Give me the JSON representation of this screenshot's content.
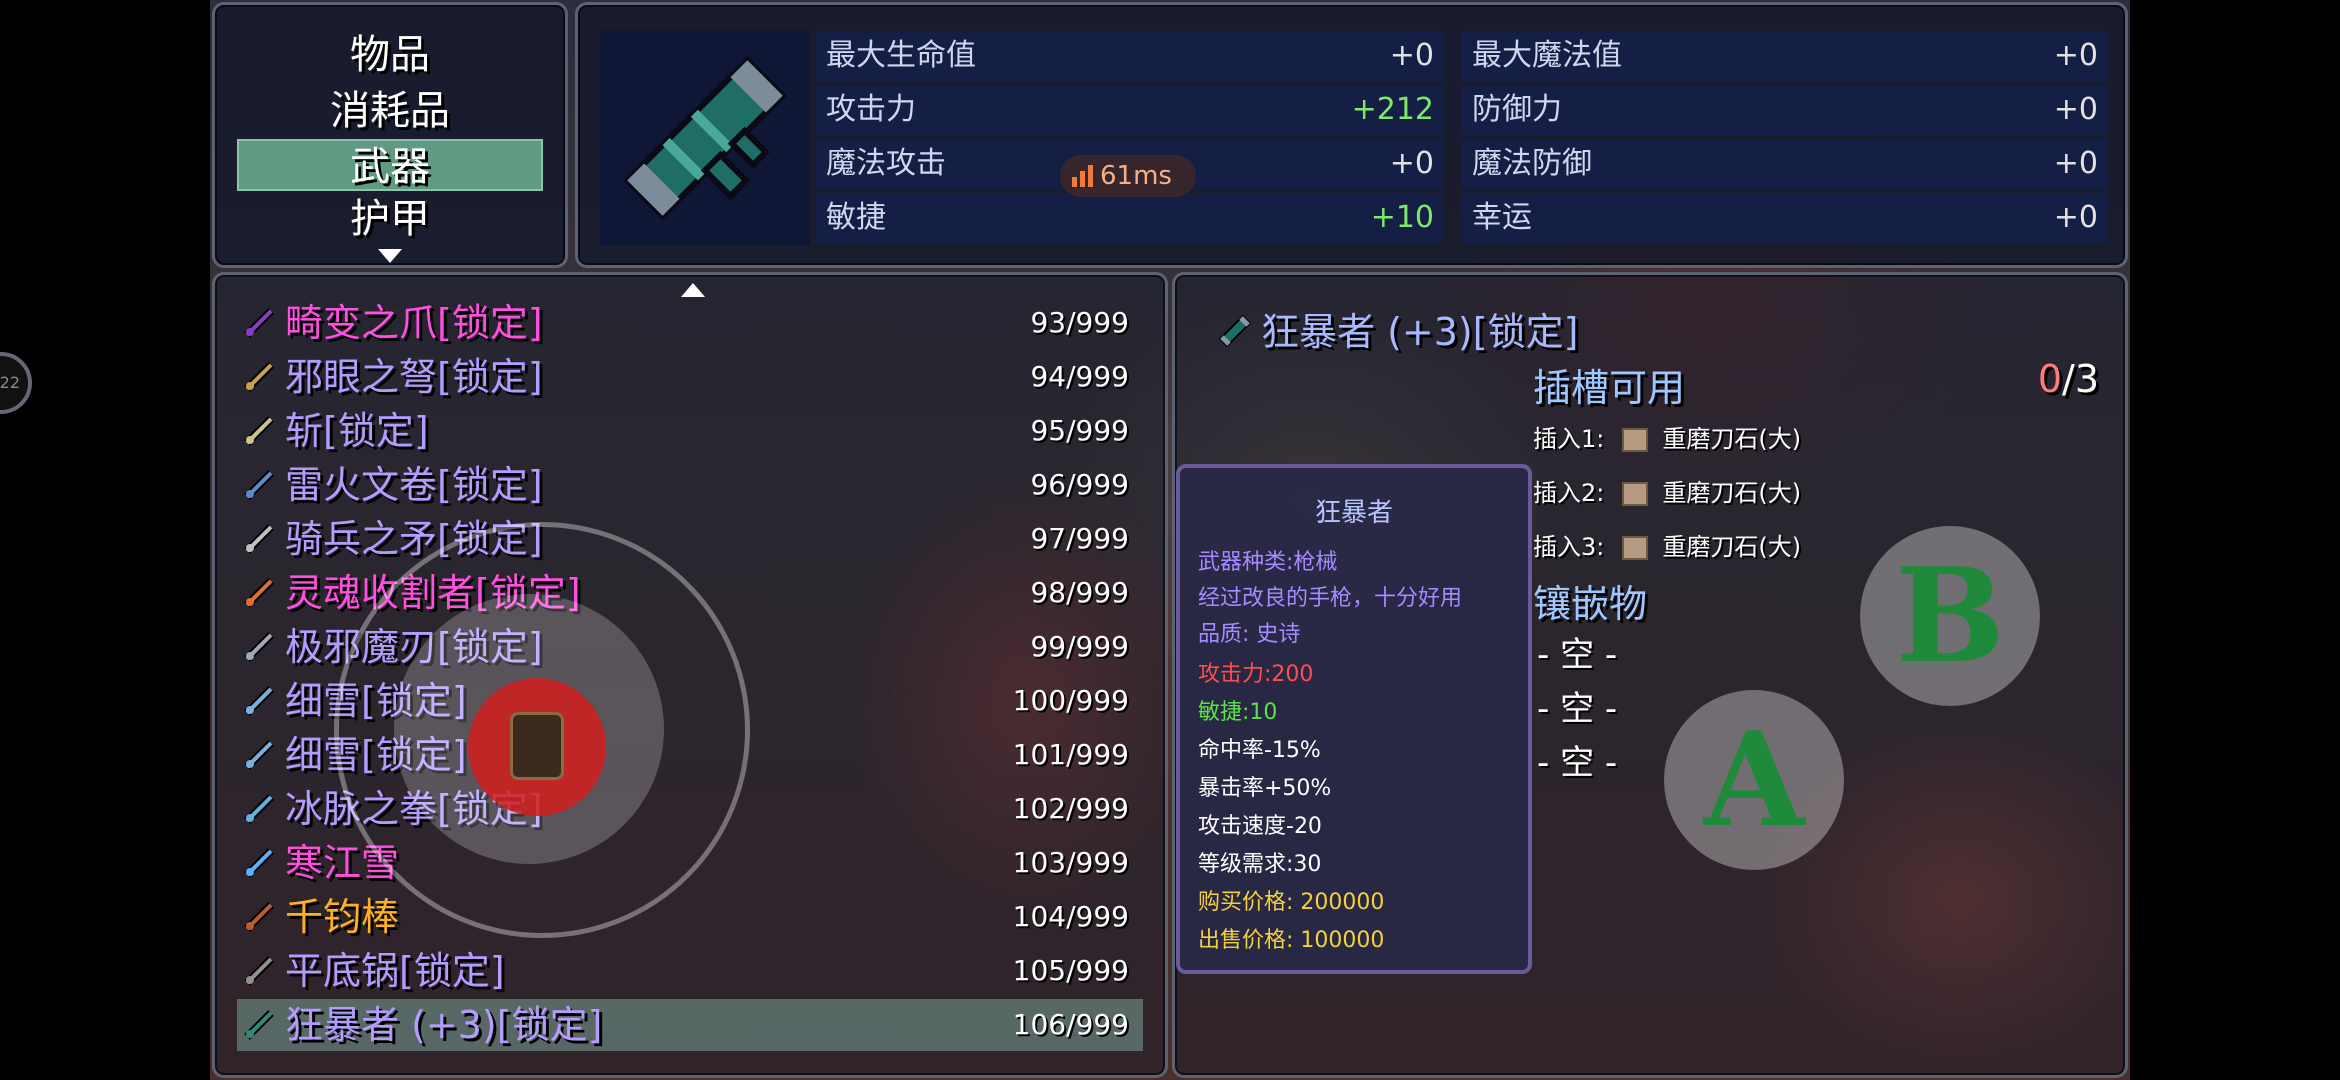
{
  "categories": {
    "items": [
      "物品",
      "消耗品",
      "武器",
      "护甲"
    ],
    "active": "武器"
  },
  "stats": {
    "rows": [
      {
        "label": "最大生命值",
        "value": "+0"
      },
      {
        "label": "最大魔法值",
        "value": "+0"
      },
      {
        "label": "攻击力",
        "value": "+212"
      },
      {
        "label": "防御力",
        "value": "+0"
      },
      {
        "label": "魔法攻击",
        "value": "+0"
      },
      {
        "label": "魔法防御",
        "value": "+0"
      },
      {
        "label": "敏捷",
        "value": "+10"
      },
      {
        "label": "幸运",
        "value": "+0"
      }
    ]
  },
  "ping": "61ms",
  "items": [
    {
      "name": "畸变之爪[锁定]",
      "count": "93/999",
      "color": "#ff4fe0",
      "icon": "claw-icon"
    },
    {
      "name": "邪眼之弩[锁定]",
      "count": "94/999",
      "color": "#b49cff",
      "icon": "crossbow-icon"
    },
    {
      "name": "斩[锁定]",
      "count": "95/999",
      "color": "#b49cff",
      "icon": "sword-icon"
    },
    {
      "name": "雷火文卷[锁定]",
      "count": "96/999",
      "color": "#b49cff",
      "icon": "scroll-icon"
    },
    {
      "name": "骑兵之矛[锁定]",
      "count": "97/999",
      "color": "#b49cff",
      "icon": "spear-icon"
    },
    {
      "name": "灵魂收割者[锁定]",
      "count": "98/999",
      "color": "#ff4fe0",
      "icon": "scythe-icon"
    },
    {
      "name": "极邪魔刃[锁定]",
      "count": "99/999",
      "color": "#b49cff",
      "icon": "blade-icon"
    },
    {
      "name": "细雪[锁定]",
      "count": "100/999",
      "color": "#b49cff",
      "icon": "katana-icon"
    },
    {
      "name": "细雪[锁定]",
      "count": "101/999",
      "color": "#b49cff",
      "icon": "katana-icon"
    },
    {
      "name": "冰脉之拳[锁定]",
      "count": "102/999",
      "color": "#b49cff",
      "icon": "fist-icon"
    },
    {
      "name": "寒江雪",
      "count": "103/999",
      "color": "#ff4fe0",
      "icon": "ice-sword-icon"
    },
    {
      "name": "千钧棒",
      "count": "104/999",
      "color": "#ffb020",
      "icon": "staff-icon"
    },
    {
      "name": "平底锅[锁定]",
      "count": "105/999",
      "color": "#b49cff",
      "icon": "pan-icon"
    },
    {
      "name": "狂暴者 (+3)[锁定]",
      "count": "106/999",
      "color": "#b49cff",
      "icon": "gun-icon"
    }
  ],
  "selected_index": 13,
  "detail": {
    "title": "狂暴者 (+3)[锁定]",
    "slots_header": "插槽可用",
    "slots_used": "0",
    "slots_total": "/3",
    "slots": [
      {
        "label": "插入1:",
        "gem": "重磨刀石(大)"
      },
      {
        "label": "插入2:",
        "gem": "重磨刀石(大)"
      },
      {
        "label": "插入3:",
        "gem": "重磨刀石(大)"
      }
    ],
    "inlay_header": "镶嵌物",
    "inlays": [
      "- 空 -",
      "- 空 -",
      "- 空 -"
    ]
  },
  "tooltip": {
    "title": "狂暴者",
    "lines": [
      {
        "text": "武器种类:枪械",
        "color": "#a58bff"
      },
      {
        "text": "经过改良的手枪，十分好用",
        "color": "#a58bff"
      },
      {
        "text": "品质: 史诗",
        "color": "#a58bff"
      },
      {
        "text": "攻击力:200",
        "color": "#ff4e4e"
      },
      {
        "text": "敏捷:10",
        "color": "#5ee04a"
      },
      {
        "text": "命中率-15%",
        "color": "#ffffff"
      },
      {
        "text": "暴击率+50%",
        "color": "#ffffff"
      },
      {
        "text": "攻击速度-20",
        "color": "#ffffff"
      },
      {
        "text": "等级需求:30",
        "color": "#ffffff"
      },
      {
        "text": "购买价格: 200000",
        "color": "#f2d23a"
      },
      {
        "text": "出售价格: 100000",
        "color": "#f2d23a"
      }
    ]
  },
  "controls": {
    "a_label": "A",
    "b_label": "B",
    "side_label": "22"
  }
}
